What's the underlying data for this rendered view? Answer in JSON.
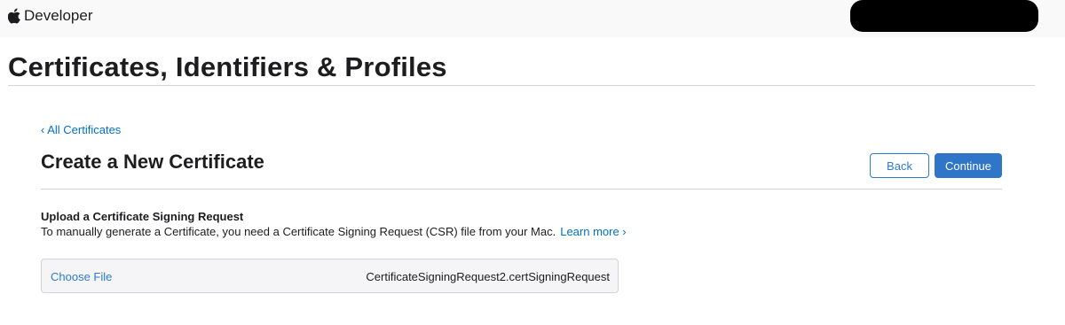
{
  "header": {
    "brand_icon": "apple-logo-icon",
    "brand_label": "Developer"
  },
  "page": {
    "title": "Certificates, Identifiers & Profiles"
  },
  "main": {
    "back_link": "‹ All Certificates",
    "section_title": "Create a New Certificate",
    "back_button": "Back",
    "continue_button": "Continue",
    "upload_heading": "Upload a Certificate Signing Request",
    "upload_description": "To manually generate a Certificate, you need a Certificate Signing Request (CSR) file from your Mac.",
    "learn_more": "Learn more ›",
    "file_picker": {
      "choose_label": "Choose File",
      "selected_file": "CertificateSigningRequest2.certSigningRequest"
    }
  },
  "colors": {
    "link": "#0070c9",
    "primary_button": "#2f76c9",
    "nav_background": "#f9f9f9"
  }
}
